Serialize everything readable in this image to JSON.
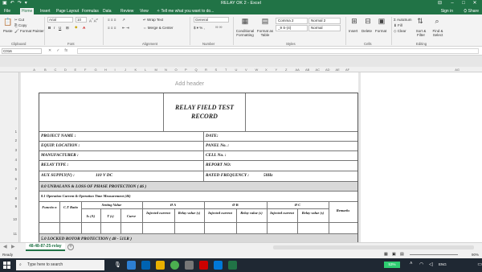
{
  "window": {
    "title": "RELAY OK 2 - Excel",
    "ribbon_options_icon": "ribbon-display-options-icon"
  },
  "tabs": [
    "File",
    "Home",
    "Insert",
    "Page Layout",
    "Formulas",
    "Data",
    "Review",
    "View"
  ],
  "active_tab": "Home",
  "tell_me": "Tell me what you want to do...",
  "sign_in": "Sign in",
  "share": "Share",
  "ribbon": {
    "clipboard": {
      "paste": "Paste",
      "cut": "Cut",
      "copy": "Copy",
      "format_painter": "Format Painter",
      "group": "Clipboard"
    },
    "font": {
      "name": "Arial",
      "size": "10",
      "group": "Font"
    },
    "alignment": {
      "wrap_text": "Wrap Text",
      "merge_center": "Merge & Center",
      "group": "Alignment"
    },
    "number": {
      "format": "General",
      "group": "Number"
    },
    "styles": {
      "conditional": "Conditional Formatting",
      "format_table": "Format as Table",
      "cell_styles": [
        "Comma 2",
        "Normal 2",
        "_9 S-(4)",
        "Normal"
      ],
      "group": "Styles"
    },
    "cells": {
      "insert": "Insert",
      "delete": "Delete",
      "format": "Format",
      "group": "Cells"
    },
    "editing": {
      "autosum": "AutoSum",
      "fill": "Fill",
      "clear": "Clear",
      "sort_filter": "Sort & Filter",
      "find_select": "Find & Select",
      "group": "Editing"
    }
  },
  "formula_bar": {
    "name_box": "C016",
    "fx": "fx",
    "value": ""
  },
  "columns": [
    "A",
    "B",
    "C",
    "D",
    "E",
    "F",
    "G",
    "H",
    "I",
    "J",
    "K",
    "L",
    "M",
    "N",
    "O",
    "P",
    "Q",
    "R",
    "S",
    "T",
    "U",
    "V",
    "W",
    "X",
    "Y",
    "Z",
    "AA",
    "AB",
    "AC",
    "AD",
    "AE",
    "AF",
    "AG",
    "AH",
    "AI",
    "AJ"
  ],
  "rows": [
    "1",
    "2",
    "3",
    "4",
    "5",
    "6",
    "7",
    "8",
    "9",
    "10",
    "11",
    "12"
  ],
  "add_header": "Add header",
  "form": {
    "title_line1": "RELAY FIELD TEST",
    "title_line2": "RECORD",
    "project_name": "PROJECT NAME :",
    "date": "DATE:",
    "equip_location": "EQUIP. LOCATION :",
    "panel_no": "PANEL No. :",
    "manufacturer": "MANUFACTURER :",
    "cell_no": "CELL No. :",
    "relay_type": "RELAY TYPE :",
    "report_no": "REPORT NO:",
    "aux_supply": "AUX SUPPLY(V) :",
    "aux_supply_value": "110 V DC",
    "rated_frequency": "RATED FREQUENCY :",
    "rated_frequency_value": "50Hz",
    "section_8": "8.0   UNBALANS & LOSS OF PHASE PROTECTION  ( 46 )",
    "section_8_1": "8.1  Operation Current & Operation Time Measurement (46)",
    "col_function": "Functio n",
    "col_ct_ratio": "C.T Ratio",
    "col_setting_value": "Setting Value",
    "col_is": "Is (A)",
    "col_t": "T (s)",
    "col_curve": "Curve",
    "phase_a": "Ø A",
    "phase_b": "Ø B",
    "phase_c": "Ø C",
    "injected_current": "Injected current",
    "relay_value": "Relay value (s)",
    "remarks": "Remarks",
    "section_5": "5.0   LOCKED ROTOR  PROTECTION  ( 48 - 51LR )"
  },
  "sheet_tab": "48-48-87-25-relay",
  "status": {
    "ready": "Ready",
    "zoom": "90%"
  },
  "taskbar": {
    "search_placeholder": "Type here to search",
    "battery": "53%",
    "lang": "ENG",
    "time": "",
    "date": ""
  }
}
